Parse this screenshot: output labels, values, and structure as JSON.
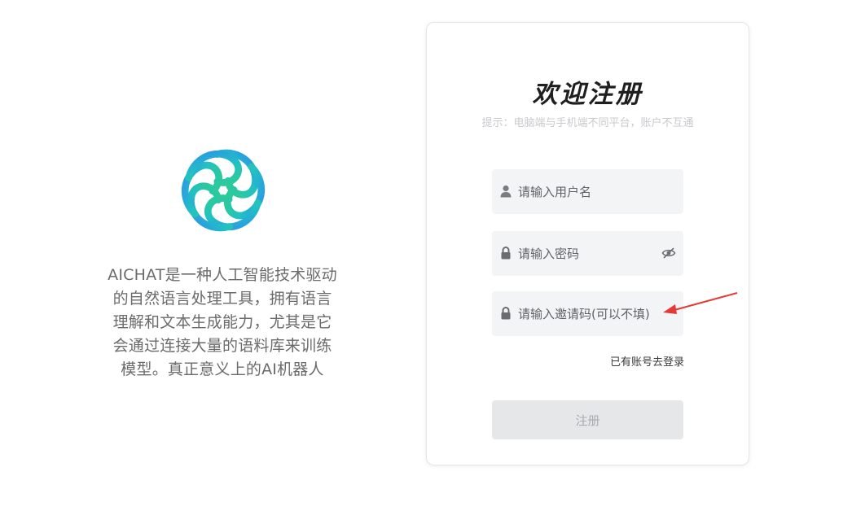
{
  "brand": {
    "description_lines": [
      "AICHAT是一种人工智能技术驱动",
      "的自然语言处理工具，拥有语言",
      "理解和文本生成能力，尤其是它",
      "会通过连接大量的语料库来训练",
      "模型。真正意义上的AI机器人"
    ],
    "logo_icon": "aichat-logo-icon",
    "logo_colors": [
      "#2ecf8f",
      "#25c2c8",
      "#2a9cf0"
    ]
  },
  "card": {
    "title": "欢迎注册",
    "tip": "提示：电脑端与手机端不同平台，账户不互通",
    "username": {
      "placeholder": "请输入用户名",
      "value": "",
      "icon": "user-icon"
    },
    "password": {
      "placeholder": "请输入密码",
      "value": "",
      "icon": "lock-icon",
      "toggle_icon": "eye-off-icon"
    },
    "invite": {
      "placeholder": "请输入邀请码(可以不填)",
      "value": "",
      "icon": "lock-icon"
    },
    "login_link": "已有账号去登录",
    "register_button": "注册"
  },
  "colors": {
    "accent_arrow": "#e53935",
    "button_bg": "#e6e7e9",
    "input_bg": "#f3f4f5"
  }
}
